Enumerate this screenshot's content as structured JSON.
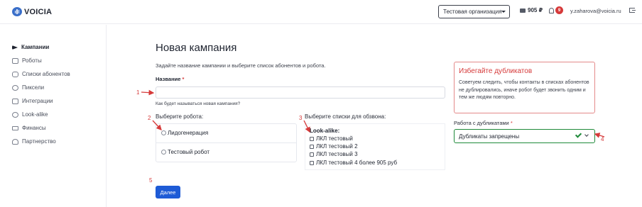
{
  "header": {
    "logo_text": "VOICIA",
    "organization": "Тестовая организация",
    "balance": "905 ₽",
    "notifications_count": "9",
    "user_email": "y.zaharova@voicia.ru",
    "icons": [
      "voicia-logo-icon",
      "wallet-icon",
      "bell-icon",
      "logout-icon"
    ]
  },
  "sidebar": {
    "items": [
      {
        "label": "Кампании",
        "icon": "megaphone-icon",
        "active": true
      },
      {
        "label": "Роботы",
        "icon": "robot-icon",
        "active": false
      },
      {
        "label": "Списки абонентов",
        "icon": "database-icon",
        "active": false
      },
      {
        "label": "Пиксели",
        "icon": "globe-icon",
        "active": false
      },
      {
        "label": "Интеграции",
        "icon": "plug-icon",
        "active": false
      },
      {
        "label": "Look-alike",
        "icon": "lookalike-icon",
        "active": false
      },
      {
        "label": "Финансы",
        "icon": "money-icon",
        "active": false
      },
      {
        "label": "Партнерство",
        "icon": "partners-icon",
        "active": false
      }
    ]
  },
  "main": {
    "title": "Новая кампания",
    "subtitle": "Задайте название кампании и выберите список абонентов и робота.",
    "name_label": "Название",
    "required_mark": "*",
    "name_value": "",
    "name_hint": "Как будет называться новая кампания?",
    "robot_label": "Выберите робота:",
    "robots": [
      "Лидогенерация",
      "Тестовый робот"
    ],
    "lists_label": "Выберите списки для обзвона:",
    "lists_group": "Look-alike:",
    "lists": [
      "ЛКЛ тестовый",
      "ЛКЛ тестовый 2",
      "ЛКЛ тестовый 3",
      "ЛКЛ тестовый 4 более 905 руб"
    ],
    "next_button": "Далее"
  },
  "duplicates": {
    "alert_title": "Избегайте дубликатов",
    "alert_text": "Советуем следить, чтобы контакты в списках абонентов не дублировались, иначе робот будет звонить одним и тем же людям повторно.",
    "select_label": "Работа с дубликатами",
    "required_mark": "*",
    "select_value": "Дубликаты запрещены"
  },
  "annotations": [
    "1",
    "2",
    "3",
    "4",
    "5"
  ],
  "colors": {
    "accent": "#1e5bd6",
    "alert": "#d63a3a",
    "success": "#1f8a3a"
  }
}
